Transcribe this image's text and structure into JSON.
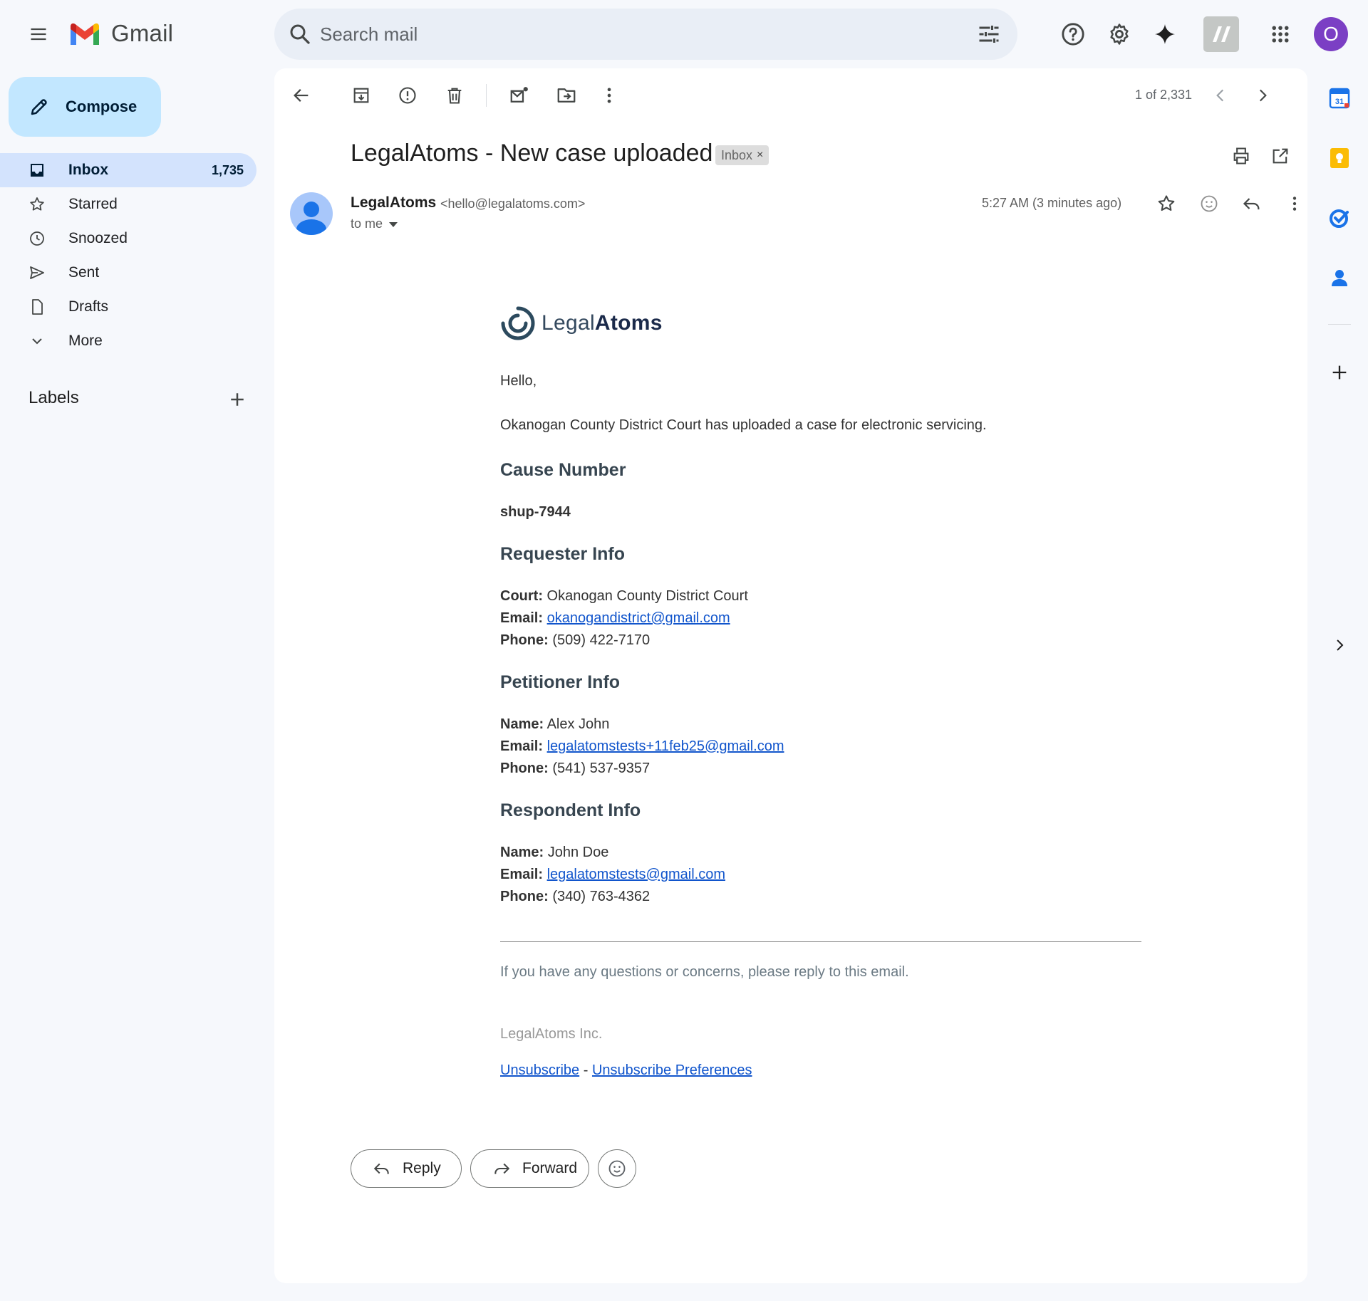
{
  "app": {
    "name": "Gmail",
    "account_initial": "O"
  },
  "search": {
    "placeholder": "Search mail"
  },
  "compose_label": "Compose",
  "nav": {
    "items": [
      {
        "label": "Inbox",
        "count": "1,735"
      },
      {
        "label": "Starred"
      },
      {
        "label": "Snoozed"
      },
      {
        "label": "Sent"
      },
      {
        "label": "Drafts"
      },
      {
        "label": "More"
      }
    ],
    "labels_heading": "Labels"
  },
  "toolbar": {
    "pager": "1 of 2,331"
  },
  "email": {
    "subject": "LegalAtoms - New case uploaded",
    "chip": "Inbox",
    "chip_close": "×",
    "sender_name": "LegalAtoms",
    "sender_email": "<hello@legalatoms.com>",
    "to": "to me",
    "timestamp": "5:27 AM (3 minutes ago)"
  },
  "body": {
    "brand_light": "Legal",
    "brand_bold": "Atoms",
    "greeting": "Hello,",
    "intro": "Okanogan County District Court has uploaded a case for electronic servicing.",
    "cause_heading": "Cause Number",
    "cause_number": "shup-7944",
    "requester": {
      "heading": "Requester Info",
      "court_label": "Court:",
      "court": "Okanogan County District Court",
      "email_label": "Email:",
      "email": "okanogandistrict@gmail.com",
      "phone_label": "Phone:",
      "phone": "(509) 422-7170"
    },
    "petitioner": {
      "heading": "Petitioner Info",
      "name_label": "Name:",
      "name": "Alex John",
      "email_label": "Email:",
      "email": "legalatomstests+11feb25@gmail.com",
      "phone_label": "Phone:",
      "phone": "(541) 537-9357"
    },
    "respondent": {
      "heading": "Respondent Info",
      "name_label": "Name:",
      "name": "John Doe",
      "email_label": "Email:",
      "email": "legalatomstests@gmail.com",
      "phone_label": "Phone:",
      "phone": "(340) 763-4362"
    },
    "footer_question": "If you have any questions or concerns, please reply to this email.",
    "company": "LegalAtoms Inc.",
    "unsubscribe": "Unsubscribe",
    "separator": "-",
    "unsubscribe_prefs": "Unsubscribe Preferences"
  },
  "actions": {
    "reply": "Reply",
    "forward": "Forward"
  },
  "rail": {
    "calendar_day": "31"
  },
  "colors": {
    "accent": "#0b57d0",
    "compose_bg": "#c2e7ff",
    "nav_active": "#d3e3fd",
    "link": "#1155cc",
    "avatar": "#7b3fc4"
  }
}
